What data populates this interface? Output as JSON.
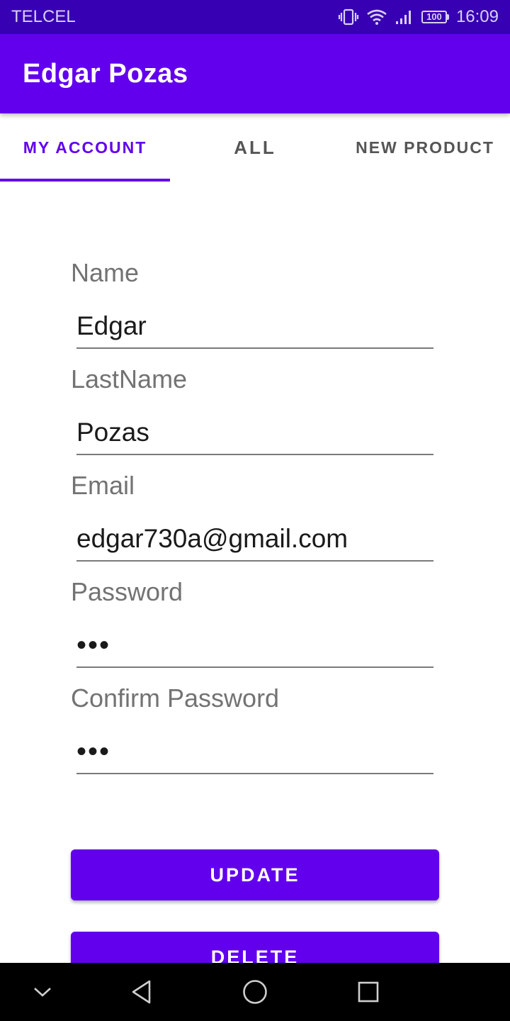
{
  "status_bar": {
    "carrier": "TELCEL",
    "battery": "100",
    "time": "16:09",
    "icons": [
      "vibrate-icon",
      "wifi-icon",
      "signal-icon",
      "battery-icon"
    ]
  },
  "app_bar": {
    "title": "Edgar Pozas"
  },
  "tabs": [
    {
      "label": "MY ACCOUNT",
      "active": true
    },
    {
      "label": "ALL",
      "active": false
    },
    {
      "label": "NEW PRODUCT",
      "active": false
    }
  ],
  "form": {
    "name": {
      "label": "Name",
      "value": "Edgar"
    },
    "last_name": {
      "label": "LastName",
      "value": "Pozas"
    },
    "email": {
      "label": "Email",
      "value": "edgar730a@gmail.com"
    },
    "password": {
      "label": "Password",
      "value": "•••"
    },
    "confirm_password": {
      "label": "Confirm Password",
      "value": "•••"
    }
  },
  "buttons": {
    "update": "UPDATE",
    "delete": "DELETE"
  },
  "nav_bar": {
    "icons": [
      "collapse-icon",
      "back-icon",
      "home-icon",
      "recents-icon"
    ]
  },
  "colors": {
    "primary": "#6200ee",
    "primary_dark": "#3700b3",
    "label_gray": "#737373"
  }
}
